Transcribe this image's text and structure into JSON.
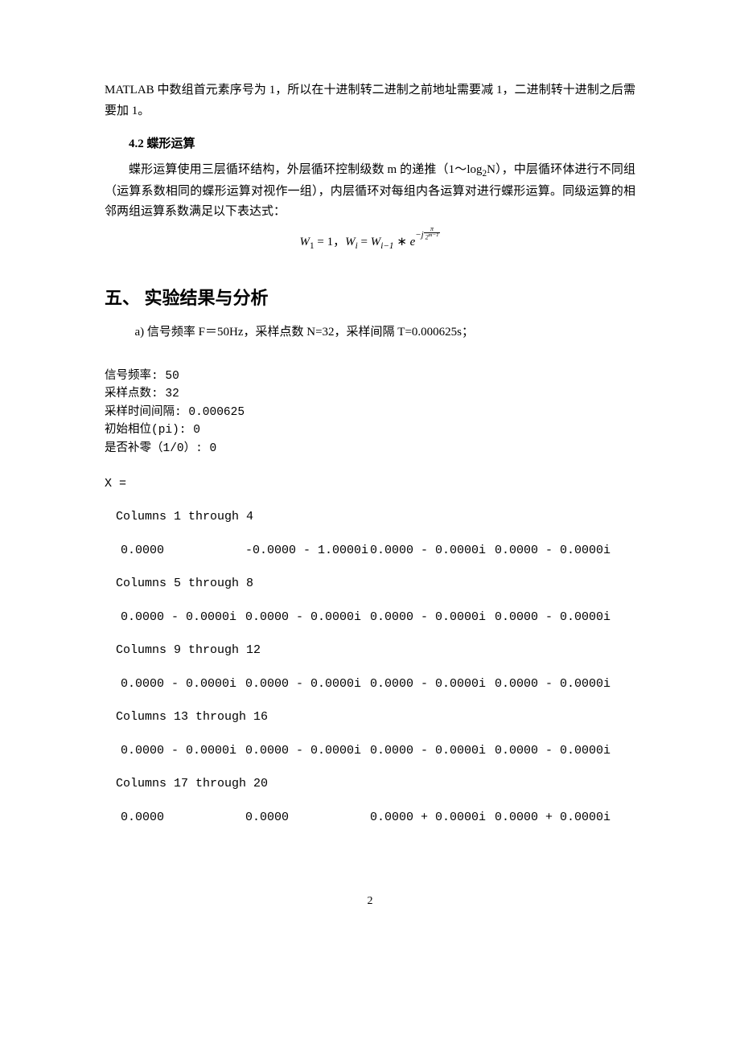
{
  "intro_para": "MATLAB 中数组首元素序号为 1，所以在十进制转二进制之前地址需要减 1，二进制转十进制之后需要加 1。",
  "section_4_2": {
    "heading": "4.2 蝶形运算",
    "para1_part1": "蝶形运算使用三层循环结构，外层循环控制级数 m 的递推（1～log",
    "para1_sub": "2",
    "para1_part2": "N），中层循环体进行不同组（运算系数相同的蝶形运算对视作一组），内层循环对每组内各运算对进行蝶形运算。同级运算的相邻两组运算系数满足以下表达式："
  },
  "formula": {
    "w1_eq": "W",
    "w1_sub": "1",
    "eq1": " = 1，",
    "wi": "W",
    "wi_sub": "i",
    "eq2": " = ",
    "wi_1": "W",
    "wi_1_sub": "i−1",
    "times": " ∗ ",
    "e": "e",
    "exp_prefix": "−j",
    "frac_top": "π",
    "frac_bot": "2",
    "frac_bot_exp": "m−1"
  },
  "section_5": {
    "title": "五、 实验结果与分析",
    "item_a": "a)   信号频率 F＝50Hz，采样点数 N=32，采样间隔 T=0.000625s；"
  },
  "console": {
    "l1_label": "信号频率: ",
    "l1_val": "50",
    "l2_label": "采样点数: ",
    "l2_val": "32",
    "l3_label": "采样时间间隔: ",
    "l3_val": "0.000625",
    "l4_label": "初始相位(pi): ",
    "l4_val": "0",
    "l5_label": "是否补零（1/0）: ",
    "l5_val": "0"
  },
  "output": {
    "var": "X =",
    "groups": [
      {
        "header": "Columns 1 through 4",
        "values": [
          "0.0000          ",
          "-0.0000 - 1.0000i",
          " 0.0000 - 0.0000i",
          " 0.0000 - 0.0000i"
        ]
      },
      {
        "header": "Columns 5 through 8",
        "values": [
          " 0.0000 - 0.0000i",
          " 0.0000 - 0.0000i",
          " 0.0000 - 0.0000i",
          " 0.0000 - 0.0000i"
        ]
      },
      {
        "header": "Columns 9 through 12",
        "values": [
          " 0.0000 - 0.0000i",
          " 0.0000 - 0.0000i",
          " 0.0000 - 0.0000i",
          " 0.0000 - 0.0000i"
        ]
      },
      {
        "header": "Columns 13 through 16",
        "values": [
          " 0.0000 - 0.0000i",
          " 0.0000 - 0.0000i",
          " 0.0000 - 0.0000i",
          " 0.0000 - 0.0000i"
        ]
      },
      {
        "header": "Columns 17 through 20",
        "values": [
          "0.0000          ",
          "0.0000          ",
          " 0.0000 + 0.0000i",
          " 0.0000 + 0.0000i"
        ]
      }
    ]
  },
  "page_num": "2"
}
